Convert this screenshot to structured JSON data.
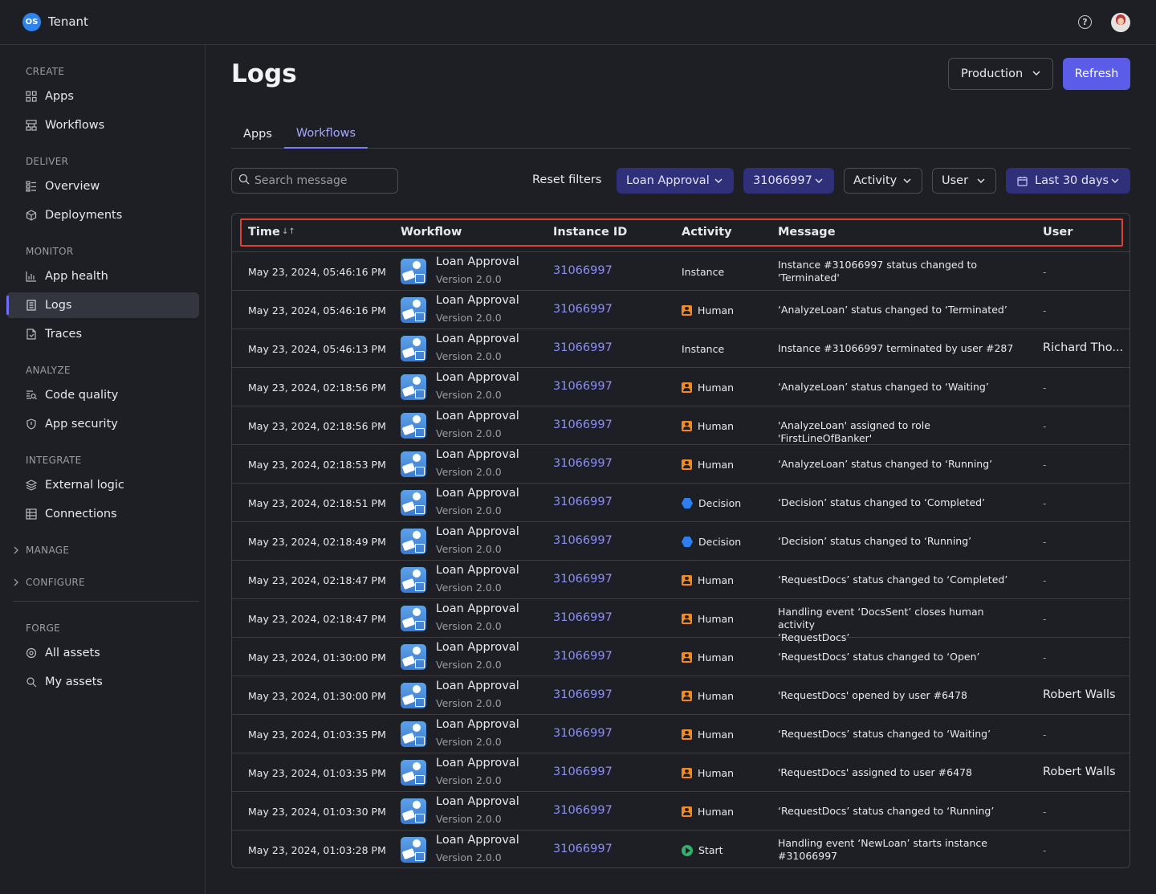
{
  "app": {
    "logo_text": "OS",
    "tenant": "Tenant"
  },
  "topbar": {
    "help_icon": "?"
  },
  "sidebar": {
    "sections": {
      "create": "CREATE",
      "deliver": "DELIVER",
      "monitor": "MONITOR",
      "analyze": "ANALYZE",
      "integrate": "INTEGRATE",
      "manage": "MANAGE",
      "configure": "CONFIGURE",
      "forge": "FORGE"
    },
    "items": {
      "apps": "Apps",
      "workflows": "Workflows",
      "overview": "Overview",
      "deployments": "Deployments",
      "app_health": "App health",
      "logs": "Logs",
      "traces": "Traces",
      "code_quality": "Code quality",
      "app_security": "App security",
      "external_logic": "External logic",
      "connections": "Connections",
      "all_assets": "All assets",
      "my_assets": "My assets"
    }
  },
  "page": {
    "title": "Logs",
    "environment": "Production",
    "refresh": "Refresh",
    "tabs": [
      "Apps",
      "Workflows"
    ],
    "active_tab": "Workflows"
  },
  "filters": {
    "search_placeholder": "Search message",
    "reset": "Reset filters",
    "workflow": "Loan Approval",
    "instance": "31066997",
    "activity": "Activity",
    "user": "User",
    "date_range": "Last 30 days"
  },
  "table": {
    "headers": {
      "time": "Time",
      "workflow": "Workflow",
      "instance": "Instance ID",
      "activity": "Activity",
      "message": "Message",
      "user": "User"
    },
    "rows": [
      {
        "time": "May 23, 2024, 05:46:16 PM",
        "workflow": "Loan Approval",
        "version": "Version 2.0.0",
        "instance": "31066997",
        "activity_type": "none",
        "activity": "Instance",
        "message_lines": [
          "Instance #31066997 status changed to",
          "'Terminated'"
        ],
        "user": "-"
      },
      {
        "time": "May 23, 2024, 05:46:16 PM",
        "workflow": "Loan Approval",
        "version": "Version 2.0.0",
        "instance": "31066997",
        "activity_type": "human",
        "activity": "Human",
        "message_lines": [
          "‘AnalyzeLoan’ status changed to ‘Terminated’"
        ],
        "user": "-"
      },
      {
        "time": "May 23, 2024, 05:46:13 PM",
        "workflow": "Loan Approval",
        "version": "Version 2.0.0",
        "instance": "31066997",
        "activity_type": "none",
        "activity": "Instance",
        "message_lines": [
          "Instance #31066997 terminated by user #287"
        ],
        "user": "Richard Tho..."
      },
      {
        "time": "May 23, 2024, 02:18:56 PM",
        "workflow": "Loan Approval",
        "version": "Version 2.0.0",
        "instance": "31066997",
        "activity_type": "human",
        "activity": "Human",
        "message_lines": [
          "‘AnalyzeLoan’ status changed to ‘Waiting’"
        ],
        "user": "-"
      },
      {
        "time": "May 23, 2024, 02:18:56 PM",
        "workflow": "Loan Approval",
        "version": "Version 2.0.0",
        "instance": "31066997",
        "activity_type": "human",
        "activity": "Human",
        "message_lines": [
          "'AnalyzeLoan' assigned to role 'FirstLineOfBanker'"
        ],
        "user": "-"
      },
      {
        "time": "May 23, 2024, 02:18:53 PM",
        "workflow": "Loan Approval",
        "version": "Version 2.0.0",
        "instance": "31066997",
        "activity_type": "human",
        "activity": "Human",
        "message_lines": [
          "‘AnalyzeLoan’ status changed to ‘Running’"
        ],
        "user": "-"
      },
      {
        "time": "May 23, 2024, 02:18:51 PM",
        "workflow": "Loan Approval",
        "version": "Version 2.0.0",
        "instance": "31066997",
        "activity_type": "decision",
        "activity": "Decision",
        "message_lines": [
          "‘Decision’ status changed to ‘Completed’"
        ],
        "user": "-"
      },
      {
        "time": "May 23, 2024, 02:18:49 PM",
        "workflow": "Loan Approval",
        "version": "Version 2.0.0",
        "instance": "31066997",
        "activity_type": "decision",
        "activity": "Decision",
        "message_lines": [
          "‘Decision’ status changed to ‘Running’"
        ],
        "user": "-"
      },
      {
        "time": "May 23, 2024, 02:18:47 PM",
        "workflow": "Loan Approval",
        "version": "Version 2.0.0",
        "instance": "31066997",
        "activity_type": "human",
        "activity": "Human",
        "message_lines": [
          "‘RequestDocs’ status changed to ‘Completed’"
        ],
        "user": "-"
      },
      {
        "time": "May 23, 2024, 02:18:47 PM",
        "workflow": "Loan Approval",
        "version": "Version 2.0.0",
        "instance": "31066997",
        "activity_type": "human",
        "activity": "Human",
        "message_lines": [
          "Handling event ‘DocsSent’ closes human activity",
          "‘RequestDocs’"
        ],
        "user": "-"
      },
      {
        "time": "May 23, 2024, 01:30:00 PM",
        "workflow": "Loan Approval",
        "version": "Version 2.0.0",
        "instance": "31066997",
        "activity_type": "human",
        "activity": "Human",
        "message_lines": [
          "‘RequestDocs’ status changed to ‘Open’"
        ],
        "user": "-"
      },
      {
        "time": "May 23, 2024, 01:30:00 PM",
        "workflow": "Loan Approval",
        "version": "Version 2.0.0",
        "instance": "31066997",
        "activity_type": "human",
        "activity": "Human",
        "message_lines": [
          "'RequestDocs' opened by user #6478"
        ],
        "user": "Robert Walls"
      },
      {
        "time": "May 23, 2024, 01:03:35 PM",
        "workflow": "Loan Approval",
        "version": "Version 2.0.0",
        "instance": "31066997",
        "activity_type": "human",
        "activity": "Human",
        "message_lines": [
          "‘RequestDocs’ status changed to ‘Waiting’"
        ],
        "user": "-"
      },
      {
        "time": "May 23, 2024, 01:03:35 PM",
        "workflow": "Loan Approval",
        "version": "Version 2.0.0",
        "instance": "31066997",
        "activity_type": "human",
        "activity": "Human",
        "message_lines": [
          "'RequestDocs' assigned to user #6478"
        ],
        "user": "Robert Walls"
      },
      {
        "time": "May 23, 2024, 01:03:30 PM",
        "workflow": "Loan Approval",
        "version": "Version 2.0.0",
        "instance": "31066997",
        "activity_type": "human",
        "activity": "Human",
        "message_lines": [
          "‘RequestDocs’ status changed to ‘Running’"
        ],
        "user": "-"
      },
      {
        "time": "May 23, 2024, 01:03:28 PM",
        "workflow": "Loan Approval",
        "version": "Version 2.0.0",
        "instance": "31066997",
        "activity_type": "start",
        "activity": "Start",
        "message_lines": [
          "Handling event ‘NewLoan’ starts instance",
          "#31066997"
        ],
        "user": "-"
      }
    ]
  }
}
